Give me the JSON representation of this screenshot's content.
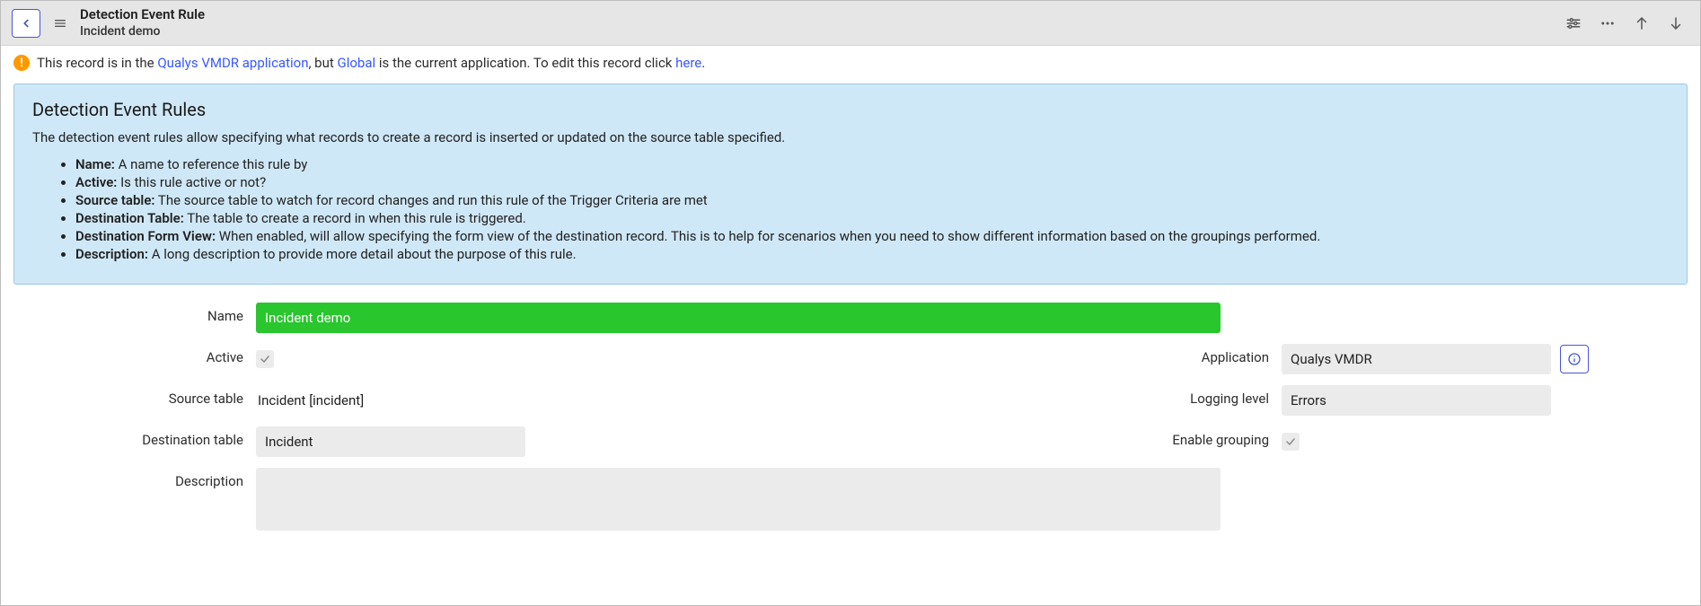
{
  "header": {
    "title": "Detection Event Rule",
    "subtitle": "Incident demo"
  },
  "alert": {
    "text_before": "This record is in the ",
    "link1": "Qualys VMDR application",
    "text_mid1": ", but ",
    "link2": "Global",
    "text_mid2": " is the current application. To edit this record click ",
    "link3": "here",
    "text_end": "."
  },
  "info": {
    "title": "Detection Event Rules",
    "description": "The detection event rules allow specifying what records to create a record is inserted or updated on the source table specified.",
    "items": [
      {
        "label": "Name:",
        "text": " A name to reference this rule by"
      },
      {
        "label": "Active:",
        "text": " Is this rule active or not?"
      },
      {
        "label": "Source table:",
        "text": " The source table to watch for record changes and run this rule of the Trigger Criteria are met"
      },
      {
        "label": "Destination Table:",
        "text": " The table to create a record in when this rule is triggered."
      },
      {
        "label": "Destination Form View:",
        "text": " When enabled, will allow specifying the form view of the destination record. This is to help for scenarios when you need to show different information based on the groupings performed."
      },
      {
        "label": "Description:",
        "text": " A long description to provide more detail about the purpose of this rule."
      }
    ]
  },
  "form": {
    "labels": {
      "name": "Name",
      "active": "Active",
      "application": "Application",
      "source_table": "Source table",
      "logging_level": "Logging level",
      "destination_table": "Destination table",
      "enable_grouping": "Enable grouping",
      "description": "Description"
    },
    "values": {
      "name": "Incident demo",
      "application": "Qualys VMDR",
      "source_table": "Incident [incident]",
      "logging_level": "Errors",
      "destination_table": "Incident",
      "description": ""
    }
  }
}
